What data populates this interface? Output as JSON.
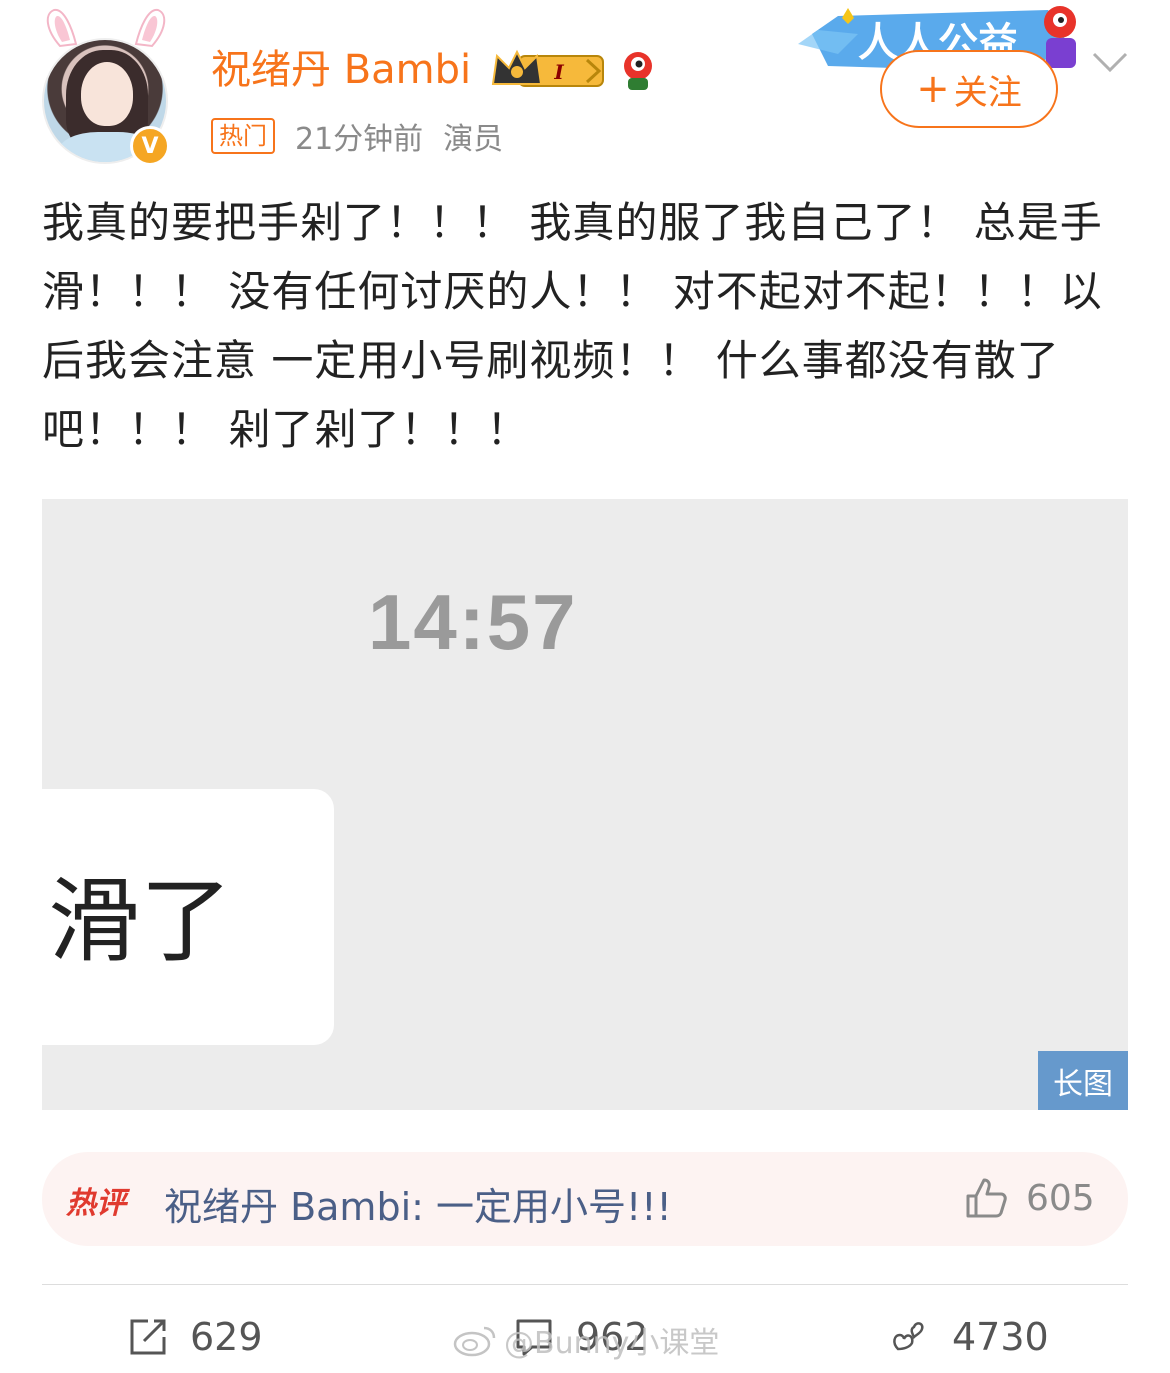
{
  "header": {
    "username": "祝绪丹 Bambi",
    "hot_tag": "热门",
    "time": "21分钟前",
    "role": "演员",
    "follow_label": "关注",
    "follow_plus": "+",
    "banner_text": "人人公益",
    "level_badge": "I"
  },
  "post": {
    "text": "我真的要把手剁了！！！ 我真的服了我自己了！ 总是手滑！！！ 没有任何讨厌的人！！ 对不起对不起！！！以后我会注意 一定用小号刷视频！！ 什么事都没有散了吧！！！ 剁了剁了！！！"
  },
  "image": {
    "time": "14:57",
    "bubble_text": "滑了",
    "long_image_label": "长图"
  },
  "hot_comment": {
    "tag": "热评",
    "text": "祝绪丹 Bambi: 一定用小号!!!",
    "likes": "605"
  },
  "actions": {
    "reposts": "629",
    "comments": "962",
    "likes": "4730"
  },
  "watermark": "@Bunny小课堂",
  "colors": {
    "accent": "#f7741b",
    "link": "#4b5f87",
    "hot": "#e03a2f",
    "long_image_badge": "#6699cc"
  }
}
